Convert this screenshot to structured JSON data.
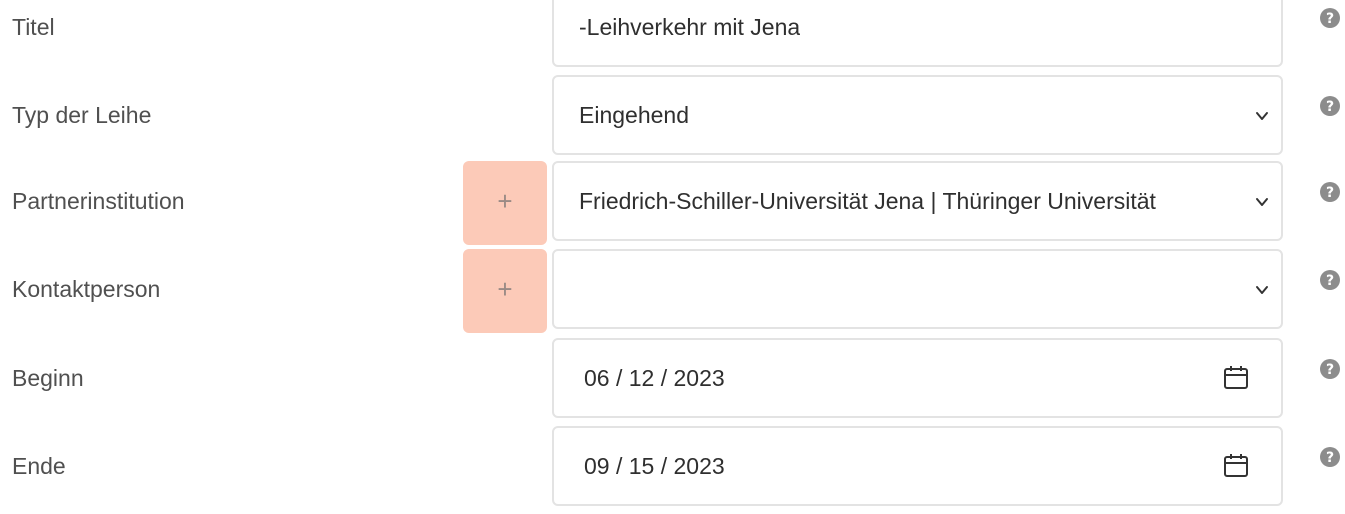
{
  "form": {
    "rows": [
      {
        "label": "Titel",
        "value": "-Leihverkehr mit Jena",
        "type": "text"
      },
      {
        "label": "Typ der Leihe",
        "value": "Eingehend",
        "type": "select"
      },
      {
        "label": "Partnerinstitution",
        "value": "Friedrich-Schiller-Universität Jena | Thüringer Universität",
        "type": "select",
        "add_label": "+"
      },
      {
        "label": "Kontaktperson",
        "value": "",
        "type": "select",
        "add_label": "+"
      },
      {
        "label": "Beginn",
        "value": "06 / 12 / 2023",
        "type": "date"
      },
      {
        "label": "Ende",
        "value": "09 / 15 / 2023",
        "type": "date"
      }
    ]
  },
  "icons": {
    "help": "question-circle-icon",
    "select": "chevron-down-icon",
    "date": "calendar-icon"
  },
  "colors": {
    "add_button_bg": "#fccab8",
    "field_border": "#e3e3e3",
    "help_icon": "#8c8c8c"
  }
}
